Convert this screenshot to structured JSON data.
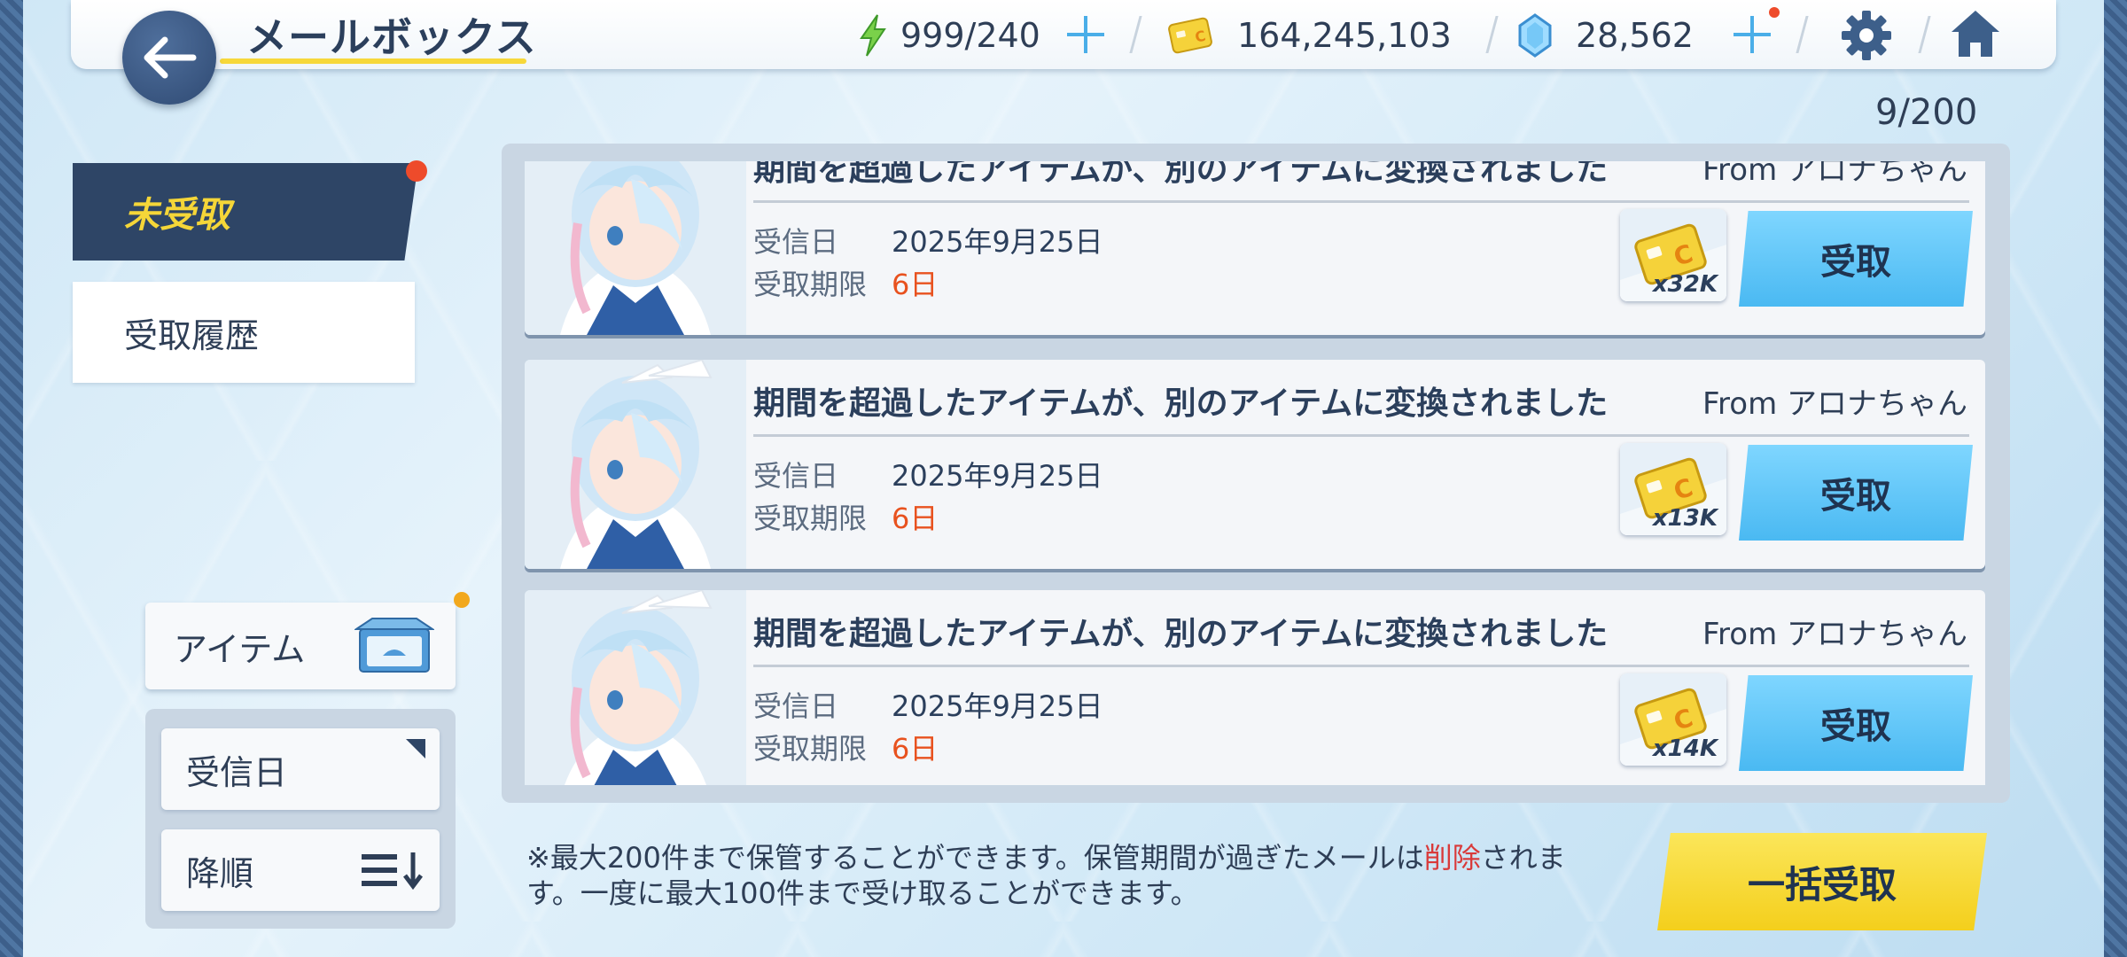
{
  "header": {
    "title": "メールボックス",
    "ap": "999/240",
    "credits": "164,245,103",
    "gems": "28,562"
  },
  "tabs": {
    "unreceived": "未受取",
    "history": "受取履歴"
  },
  "counter": "9/200",
  "filter": {
    "item": "アイテム",
    "sort_field": "受信日",
    "sort_order": "降順"
  },
  "mails": [
    {
      "title": "期間を超過したアイテムが、別のアイテムに変換されました",
      "from": "From アロナちゃん",
      "received_label": "受信日",
      "received_date": "2025年9月25日",
      "deadline_label": "受取期限",
      "deadline": "6日",
      "reward_icon": "credit-card-icon",
      "reward_qty": "x32K",
      "button": "受取"
    },
    {
      "title": "期間を超過したアイテムが、別のアイテムに変換されました",
      "from": "From アロナちゃん",
      "received_label": "受信日",
      "received_date": "2025年9月25日",
      "deadline_label": "受取期限",
      "deadline": "6日",
      "reward_icon": "credit-card-icon",
      "reward_qty": "x13K",
      "button": "受取"
    },
    {
      "title": "期間を超過したアイテムが、別のアイテムに変換されました",
      "from": "From アロナちゃん",
      "received_label": "受信日",
      "received_date": "2025年9月25日",
      "deadline_label": "受取期限",
      "deadline": "6日",
      "reward_icon": "credit-card-icon",
      "reward_qty": "x14K",
      "button": "受取"
    }
  ],
  "footer": {
    "note_part1": "※最大200件まで保管することができます。保管期間が過ぎたメールは",
    "note_red": "削除",
    "note_part2": "されます。一度に最大100件まで受け取ることができます。",
    "bulk_button": "一括受取"
  },
  "colors": {
    "accent_blue": "#4ab9f2",
    "accent_yellow": "#f4cf1c",
    "navy": "#2e4566",
    "deadline_orange": "#e8521f",
    "alert_red": "#d93a3a"
  }
}
